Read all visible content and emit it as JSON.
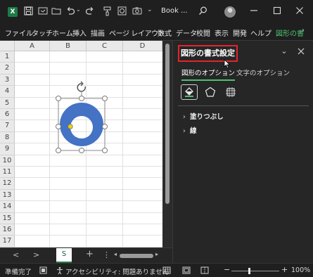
{
  "titlebar": {
    "app_icon": "excel-icon",
    "book_title": "Book ...",
    "icons": [
      "save-icon",
      "autosave-icon",
      "open-icon",
      "undo-icon",
      "redo-icon",
      "format-painter-icon",
      "shape-insert-icon",
      "camera-icon",
      "more-icon",
      "search-icon",
      "avatar",
      "minimize-icon",
      "maximize-icon",
      "close-icon"
    ]
  },
  "ribbon": {
    "tabs": [
      "ファイル",
      "タッチ",
      "ホーム",
      "挿入",
      "描画",
      "ページ レイアウト",
      "数式",
      "データ",
      "校閲",
      "表示",
      "開発",
      "ヘルプ",
      "図形の書"
    ],
    "active_tab": "図形の書",
    "active_color": "#4cc272"
  },
  "grid": {
    "columns": [
      "A",
      "B",
      "C",
      "D"
    ],
    "rows": [
      "1",
      "2",
      "3",
      "4",
      "5",
      "6",
      "7",
      "8",
      "9",
      "10",
      "11",
      "12",
      "13",
      "14",
      "15",
      "16",
      "17"
    ]
  },
  "shape": {
    "type": "donut",
    "fill_color": "#4472c4",
    "handle_color": "#f0d000",
    "rotate_icon": "rotate-icon"
  },
  "sheetbar": {
    "prev_label": "<",
    "next_label": ">",
    "sheet_name": "S",
    "add_label": "+",
    "more_label": "⋮"
  },
  "status": {
    "ready": "準備完了",
    "accessibility": "アクセシビリティ: 問題ありません",
    "zoom": "100%",
    "zoom_minus": "−",
    "zoom_plus": "+"
  },
  "pane": {
    "title": "図形の書式設定",
    "title_highlight": "#e3242b",
    "tabs": [
      "図形のオプション",
      "文字のオプション"
    ],
    "active_tab": "図形のオプション",
    "sections": [
      "塗りつぶし",
      "線"
    ]
  }
}
